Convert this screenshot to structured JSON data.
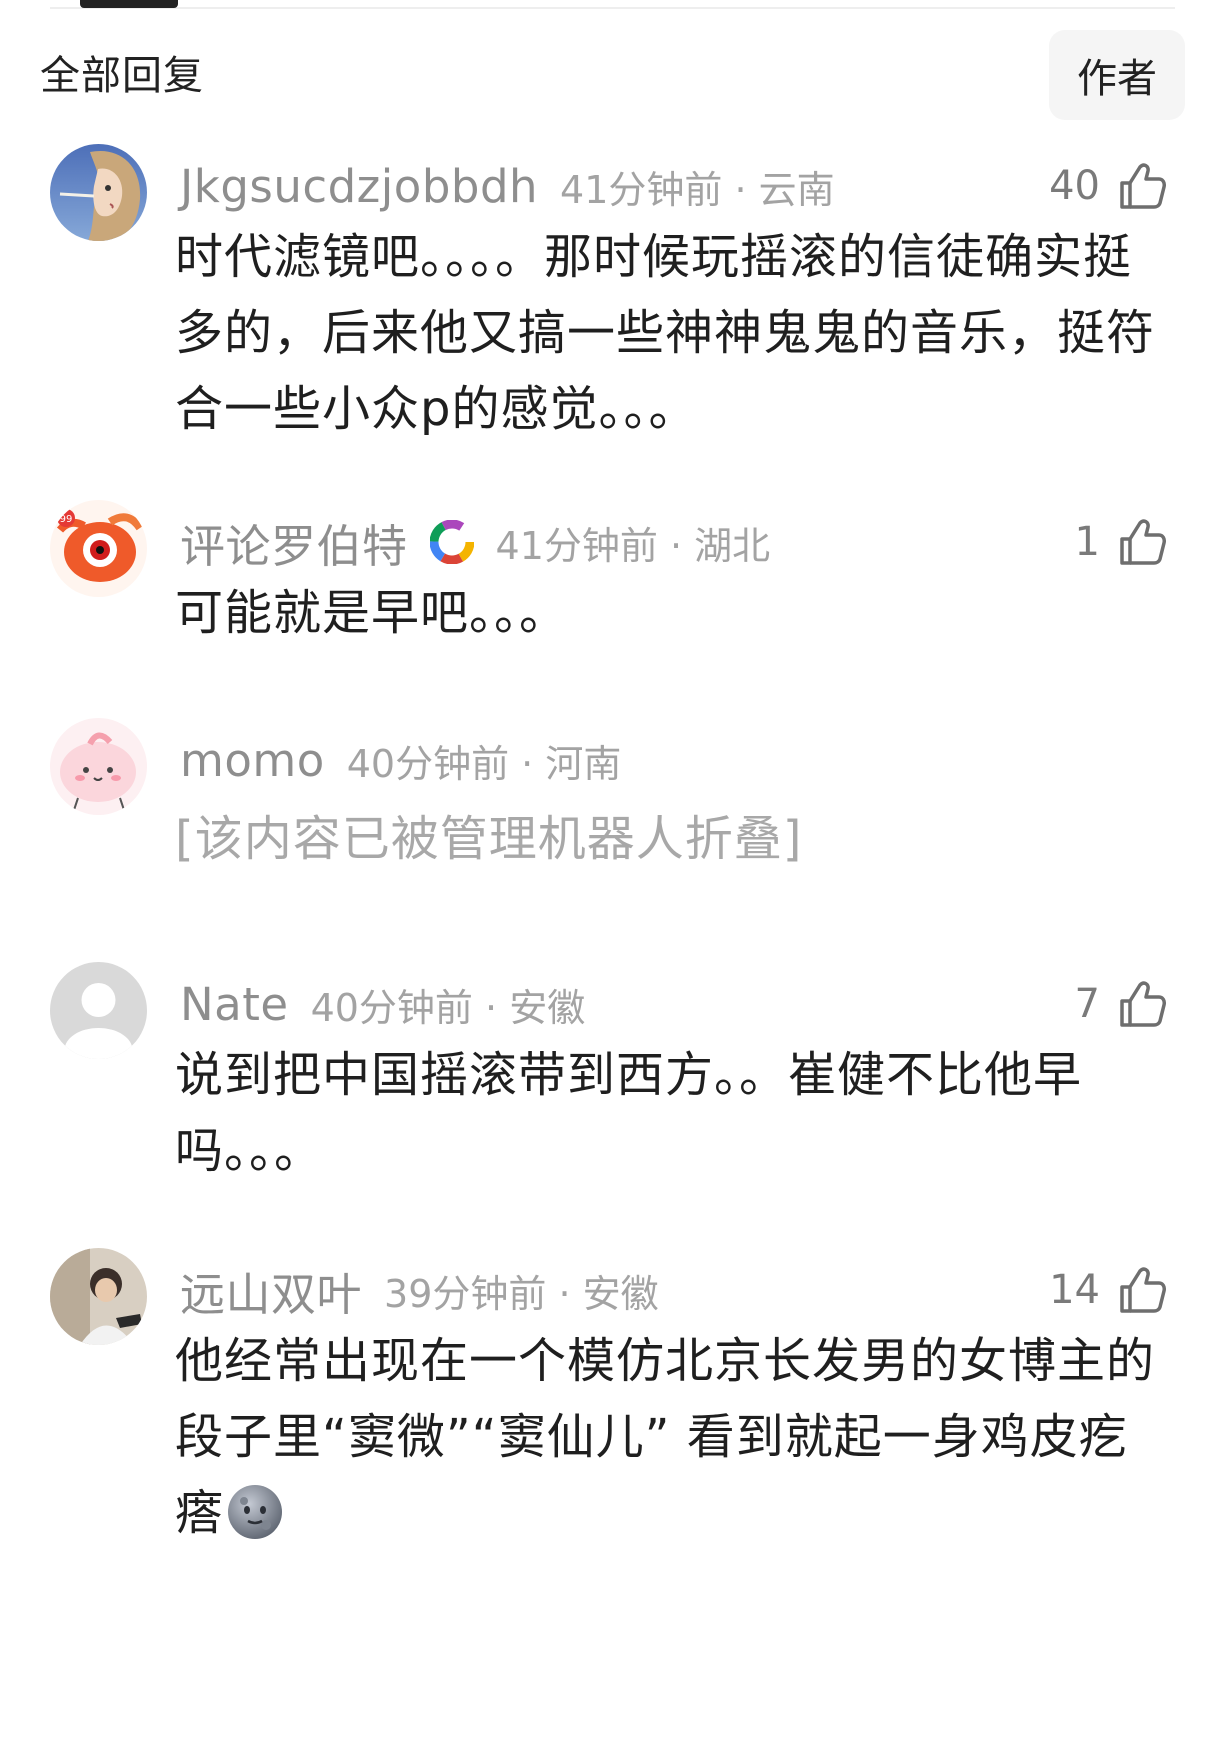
{
  "header": {
    "title": "全部回复",
    "author_button": "作者"
  },
  "comments": [
    {
      "username": "Jkgsucdzjobbdh",
      "time": "41分钟前",
      "location": "云南",
      "likes": "40",
      "text": "时代滤镜吧。。。。那时候玩摇滚的信徒确实挺多的，后来他又搞一些神神鬼鬼的音乐，挺符合一些小众p的感觉。。。",
      "avatar": "anime-girl-avatar"
    },
    {
      "username": "评论罗伯特",
      "time": "41分钟前",
      "location": "湖北",
      "likes": "1",
      "text": "可能就是早吧。。。",
      "avatar": "red-fish-mascot-avatar",
      "badge": "colorful-ring-badge"
    },
    {
      "username": "momo",
      "time": "40分钟前",
      "location": "河南",
      "text": "[该内容已被管理机器人折叠]",
      "avatar": "pink-creature-avatar"
    },
    {
      "username": "Nate",
      "time": "40分钟前",
      "location": "安徽",
      "likes": "7",
      "text": "说到把中国摇滚带到西方。。崔健不比他早吗。。。",
      "avatar": "default-gray-avatar"
    },
    {
      "username": "远山双叶",
      "time": "39分钟前",
      "location": "安徽",
      "likes": "14",
      "text": "他经常出现在一个模仿北京长发男的女博主的段子里“窦微”“窦仙儿” 看到就起一身鸡皮疙瘩",
      "avatar": "photo-avatar",
      "emoji": "moon-face-emoji"
    }
  ],
  "colors": {
    "username": "#8e8e8e",
    "meta": "#a3a3a3",
    "text": "#1f1f1f",
    "folded": "#a8a8a8",
    "author_button_bg": "#f5f5f5"
  }
}
